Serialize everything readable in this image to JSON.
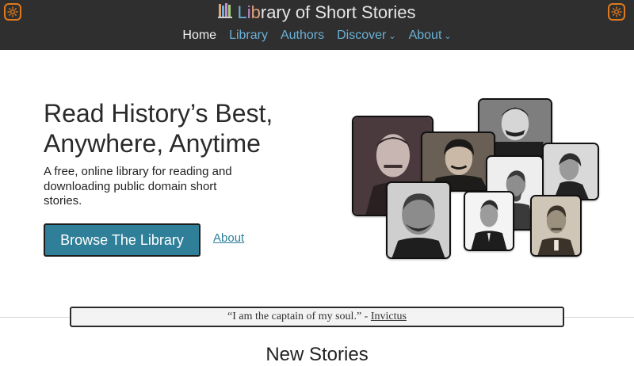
{
  "header": {
    "brand_first_letters": [
      "L",
      "i",
      "b"
    ],
    "brand_rest": "rary of Short Stories",
    "brand_letter_colors": [
      "#6ab0d6",
      "#c58ad8",
      "#e0a07a"
    ],
    "accent": "#e07a1f",
    "nav": [
      {
        "label": "Home",
        "active": true,
        "dropdown": false
      },
      {
        "label": "Library",
        "active": false,
        "dropdown": false
      },
      {
        "label": "Authors",
        "active": false,
        "dropdown": false
      },
      {
        "label": "Discover",
        "active": false,
        "dropdown": true
      },
      {
        "label": "About",
        "active": false,
        "dropdown": true
      }
    ],
    "settings_icons": [
      "settings-gear-icon",
      "settings-gear-icon"
    ]
  },
  "hero": {
    "title_line1": "Read History’s Best,",
    "title_line2": "Anywhere, Anytime",
    "subtitle": "A free, online library for reading and downloading public domain short stories.",
    "browse_button": "Browse The Library",
    "about_link": "About",
    "button_color": "#2f7f99"
  },
  "quote": {
    "text": "“I am the captain of my soul.” - ",
    "source": "Invictus"
  },
  "sections": {
    "new_stories": "New Stories"
  }
}
